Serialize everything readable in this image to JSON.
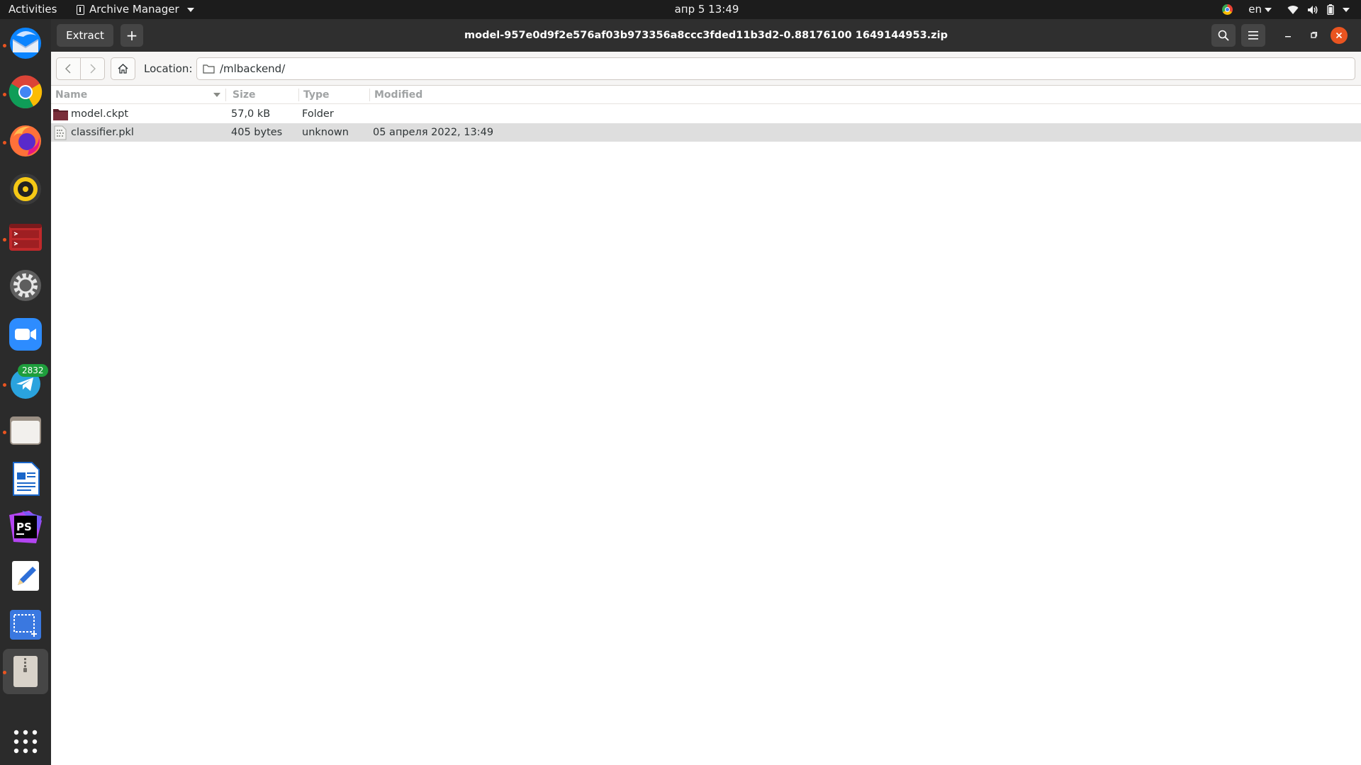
{
  "topbar": {
    "activities": "Activities",
    "app_menu": "Archive Manager",
    "clock": "апр 5  13:49",
    "language": "en"
  },
  "dock": {
    "items": [
      {
        "name": "thunderbird-icon",
        "running": true
      },
      {
        "name": "chrome-icon",
        "running": true
      },
      {
        "name": "firefox-icon",
        "running": true
      },
      {
        "name": "rhythmbox-icon",
        "running": false
      },
      {
        "name": "terminal-icon",
        "running": true
      },
      {
        "name": "settings-icon",
        "running": false
      },
      {
        "name": "zoom-icon",
        "running": false
      },
      {
        "name": "telegram-icon",
        "running": true,
        "badge": "2832"
      },
      {
        "name": "files-icon",
        "running": true
      },
      {
        "name": "writer-icon",
        "running": false
      },
      {
        "name": "phpstorm-icon",
        "running": false
      },
      {
        "name": "text-editor-icon",
        "running": false
      },
      {
        "name": "screenshot-icon",
        "running": false
      },
      {
        "name": "archive-manager-icon",
        "running": true,
        "active": true
      }
    ],
    "show_apps": "apps-grid-icon"
  },
  "window": {
    "extract_label": "Extract",
    "add_label": "+",
    "title": "model-957e0d9f2e576af03b973356a8ccc3fded11b3d2-0.88176100 1649144953.zip"
  },
  "location": {
    "label": "Location:",
    "path": "/mlbackend/"
  },
  "columns": {
    "name": "Name",
    "size": "Size",
    "type": "Type",
    "modified": "Modified"
  },
  "files": [
    {
      "name": "model.ckpt",
      "size": "57,0 kB",
      "type": "Folder",
      "modified": "",
      "icon": "folder-icon",
      "selected": false
    },
    {
      "name": "classifier.pkl",
      "size": "405 bytes",
      "type": "unknown",
      "modified": "05 апреля 2022, 13:49",
      "icon": "binary-file-icon",
      "selected": true
    }
  ],
  "colors": {
    "topbar": "#1c1c1c",
    "dock": "#2b2b2b",
    "headerbar": "#2f2f2f",
    "close_button": "#e95420",
    "selection": "#dedede",
    "folder": "#7a2e3a"
  }
}
